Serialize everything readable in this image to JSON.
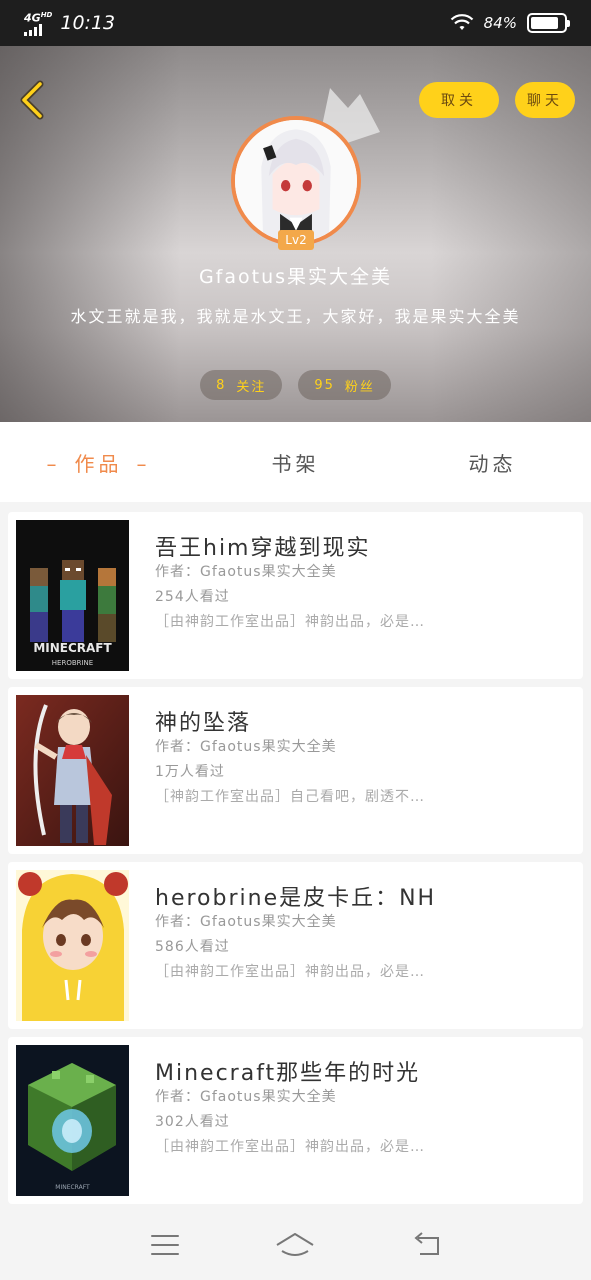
{
  "status": {
    "network": "4G",
    "network_sup": "HD",
    "time": "10:13",
    "battery": "84%",
    "battery_level": 0.84
  },
  "header": {
    "unfollow_label": "取关",
    "chat_label": "聊天",
    "level": "Lv2",
    "username": "Gfaotus果实大全美",
    "bio": "水文王就是我，我就是水文王，大家好，我是果实大全美",
    "following_count": "8",
    "following_label": "关注",
    "fans_count": "95",
    "fans_label": "粉丝"
  },
  "tabs": [
    {
      "label": "作品"
    },
    {
      "label": "书架"
    },
    {
      "label": "动态"
    }
  ],
  "works": [
    {
      "title": "吾王him穿越到现实",
      "author": "作者：Gfaotus果实大全美",
      "views": "254人看过",
      "desc": "［由神韵工作室出品］神韵出品，必是…",
      "cover_text": "MINECRAFT",
      "cover_subtext": "HEROBRINE"
    },
    {
      "title": "神的坠落",
      "author": "作者：Gfaotus果实大全美",
      "views": "1万人看过",
      "desc": "［神韵工作室出品］自己看吧，剧透不…"
    },
    {
      "title": "herobrine是皮卡丘：NH",
      "author": "作者：Gfaotus果实大全美",
      "views": "586人看过",
      "desc": "［由神韵工作室出品］神韵出品，必是…"
    },
    {
      "title": "Minecraft那些年的时光",
      "author": "作者：Gfaotus果实大全美",
      "views": "302人看过",
      "desc": "［由神韵工作室出品］神韵出品，必是…",
      "cover_text": "MINECRAFT"
    }
  ],
  "colors": {
    "accent_orange": "#f08a4b",
    "button_yellow": "#ffd11a"
  }
}
